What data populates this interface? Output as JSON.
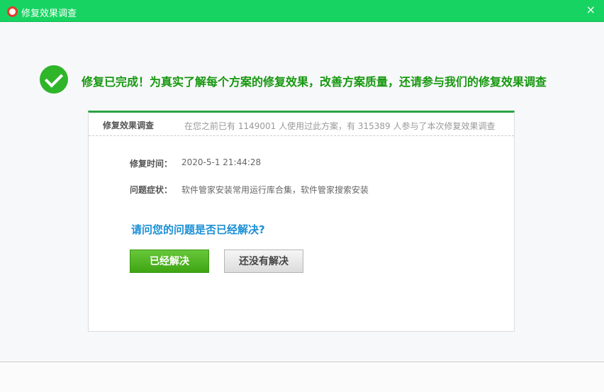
{
  "window": {
    "title": "修复效果调查",
    "close": "×"
  },
  "headline": "修复已完成！为真实了解每个方案的修复效果，改善方案质量，还请参与我们的修复效果调查",
  "panel": {
    "title": "修复效果调查",
    "info": "在您之前已有 1149001 人使用过此方案，有 315389 人参与了本次修复效果调查",
    "time_label": "修复时间：",
    "time_value": "2020-5-1 21:44:28",
    "symptom_label": "问题症状：",
    "symptom_value": "软件管家安装常用运行库合集，软件管家搜索安装",
    "question": "请问您的问题是否已经解决?",
    "yes_button": "已经解决",
    "no_button": "还没有解决"
  }
}
